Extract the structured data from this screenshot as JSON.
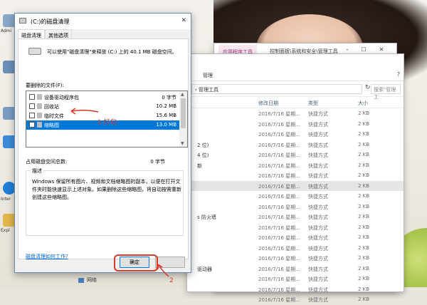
{
  "desktop": {
    "labels": [
      "Admi",
      "Inter",
      "Expl"
    ]
  },
  "explorer_back": {
    "title": "控制面板\\系统和安全\\管理工具",
    "tool_tab": "应用程序工具"
  },
  "explorer": {
    "ribbon_tab": "管理",
    "address": "› 管理工具",
    "search_placeholder": "搜索\"管理工",
    "columns": [
      "修改日期",
      "类型",
      "大小"
    ],
    "rows": [
      {
        "frag": "",
        "date": "2016/7/16 星期...",
        "type": "快捷方式",
        "size": "2 KB",
        "selected": false
      },
      {
        "frag": "",
        "date": "2016/7/16 星期...",
        "type": "快捷方式",
        "size": "2 KB",
        "selected": false
      },
      {
        "frag": "",
        "date": "2016/7/16 星期...",
        "type": "快捷方式",
        "size": "2 KB",
        "selected": false
      },
      {
        "frag": "2 位)",
        "date": "2016/7/16 星期...",
        "type": "快捷方式",
        "size": "2 KB",
        "selected": false
      },
      {
        "frag": "4 位)",
        "date": "2016/7/16 星期...",
        "type": "快捷方式",
        "size": "2 KB",
        "selected": false
      },
      {
        "frag": "新",
        "date": "2016/7/16 星期...",
        "type": "快捷方式",
        "size": "2 KB",
        "selected": false
      },
      {
        "frag": "",
        "date": "2016/7/16 星期...",
        "type": "快捷方式",
        "size": "2 KB",
        "selected": false
      },
      {
        "frag": "",
        "date": "2016/7/16 星期...",
        "type": "快捷方式",
        "size": "2 KB",
        "selected": true
      },
      {
        "frag": "",
        "date": "2016/7/16 星期...",
        "type": "快捷方式",
        "size": "2 KB",
        "selected": false
      },
      {
        "frag": "",
        "date": "2016/7/16 星期...",
        "type": "快捷方式",
        "size": "2 KB",
        "selected": false
      },
      {
        "frag": "s 防火墙",
        "date": "2016/7/16 星期...",
        "type": "快捷方式",
        "size": "2 KB",
        "selected": false
      },
      {
        "frag": "",
        "date": "2016/7/16 星期...",
        "type": "快捷方式",
        "size": "2 KB",
        "selected": false
      },
      {
        "frag": "",
        "date": "2016/7/16 星期...",
        "type": "快捷方式",
        "size": "2 KB",
        "selected": false
      },
      {
        "frag": "",
        "date": "2016/7/16 星期...",
        "type": "快捷方式",
        "size": "2 KB",
        "selected": false
      },
      {
        "frag": "",
        "date": "2016/7/16 星期...",
        "type": "快捷方式",
        "size": "2 KB",
        "selected": false
      },
      {
        "frag": "驱动器",
        "date": "2016/7/16 星期...",
        "type": "快捷方式",
        "size": "2 KB",
        "selected": false
      },
      {
        "frag": "",
        "date": "2016/7/16 星期...",
        "type": "快捷方式",
        "size": "2 KB",
        "selected": false
      },
      {
        "frag": "",
        "date": "2016/7/16 星期...",
        "type": "快捷方式",
        "size": "2 KB",
        "selected": false
      },
      {
        "frag": "",
        "date": "2016/7/16 星期...",
        "type": "快捷方式",
        "size": "2 KB",
        "selected": false
      }
    ],
    "nav_network": "网络"
  },
  "dialog": {
    "title": "(C:)的磁盘清理",
    "tabs": [
      "磁盘清理",
      "其他选项"
    ],
    "intro": "可以使用\"磁盘清理\"来释放 (C:) 上的 40.1 MB 磁盘空间。",
    "files_label": "要删除的文件(F):",
    "files": [
      {
        "name": "设备驱动程序包",
        "size": "0 字节",
        "checked": false,
        "selected": false
      },
      {
        "name": "回收站",
        "size": "10.2 MB",
        "checked": false,
        "selected": false
      },
      {
        "name": "临时文件",
        "size": "15.6 MB",
        "checked": false,
        "selected": false
      },
      {
        "name": "缩略图",
        "size": "13.0 MB",
        "checked": true,
        "selected": true
      }
    ],
    "gain_label": "占用磁盘空间总数:",
    "gain_value": "0 字节",
    "desc_title": "描述",
    "desc_text": "Windows 保留所有图片、视频和文档缩略图的副本，以便在打开文件夹时能快速显示上述对象。如果删除这些缩略图，将自动按需重新创建这些缩略图。",
    "help_link": "磁盘清理如何工作?",
    "ok_label": "确定",
    "cancel_label": ""
  },
  "annotations": {
    "step1": "1.打勾",
    "step2": "2",
    "color": "#d83a2a"
  }
}
